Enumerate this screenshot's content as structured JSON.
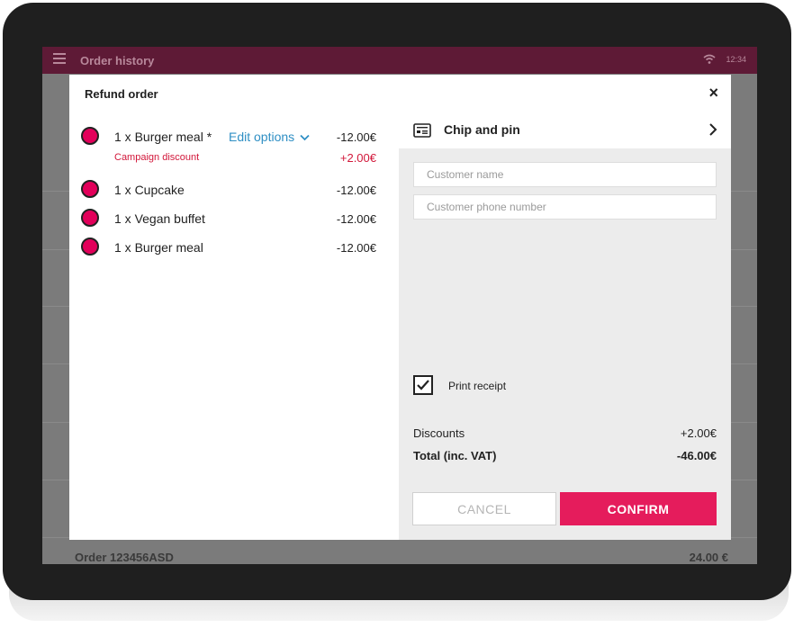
{
  "appbar": {
    "title": "Order history",
    "time": "12:34"
  },
  "background": {
    "order_label": "Order 123456ASD",
    "order_amount": "24.00 €"
  },
  "modal": {
    "title": "Refund order",
    "close_symbol": "×",
    "items": [
      {
        "label": "1 x Burger meal *",
        "price": "-12.00€"
      },
      {
        "label": "1 x Cupcake",
        "price": "-12.00€"
      },
      {
        "label": "1 x Vegan buffet",
        "price": "-12.00€"
      },
      {
        "label": "1 x Burger meal",
        "price": "-12.00€"
      }
    ],
    "edit_options_label": "Edit options",
    "campaign_discount": {
      "label": "Campaign discount",
      "price": "+2.00€"
    },
    "payment": {
      "method": "Chip and pin",
      "icon": "card-reader-icon"
    },
    "customer_name": {
      "placeholder": "Customer name",
      "value": ""
    },
    "customer_phone": {
      "placeholder": "Customer phone number",
      "value": ""
    },
    "print_receipt": {
      "label": "Print receipt",
      "checked": true
    },
    "summary": {
      "discounts_label": "Discounts",
      "discounts_value": "+2.00€",
      "total_label": "Total (inc. VAT)",
      "total_value": "-46.00€"
    },
    "cancel_label": "CANCEL",
    "confirm_label": "CONFIRM"
  },
  "colors": {
    "appbar": "#5e1a36",
    "accent": "#e51c5c",
    "link": "#2f8fc4",
    "discount": "#d2173a"
  }
}
